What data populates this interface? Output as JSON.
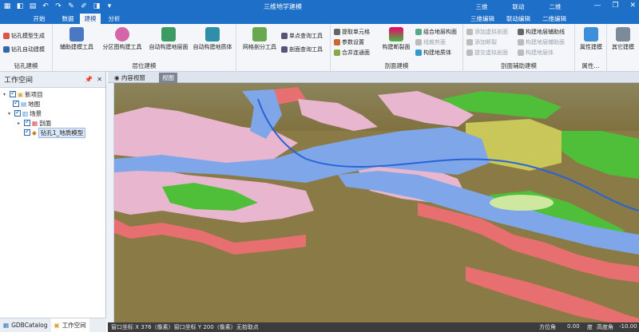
{
  "app": {
    "title": "三维地学建模"
  },
  "context_groups": {
    "g1": "三维",
    "g2": "联动",
    "g3": "二维"
  },
  "tabs": [
    "开始",
    "数据",
    "建模",
    "分析"
  ],
  "context_tabs": [
    "三维编辑",
    "联动编辑",
    "二维编辑"
  ],
  "ribbon": {
    "drill_group": {
      "label": "钻孔建模",
      "items": [
        "钻孔模型生成",
        "钻孔自动建模"
      ]
    },
    "layer_group": {
      "label": "层位建模",
      "items": [
        "辅助建模工具",
        "分区图构建工具",
        "自动构建地层面",
        "自动构建地质体"
      ]
    },
    "grid_group": {
      "items": [
        "网格剖分工具",
        "单点查询工具",
        "剖面查询工具"
      ]
    },
    "section_group": {
      "label": "剖面建模",
      "items": [
        "提取单元格",
        "参数设置",
        "合并连通面",
        "构建断裂面",
        "组合地层构面",
        "线裁剪面",
        "构建地质体"
      ]
    },
    "aux_group": {
      "label": "剖面辅助建模",
      "items": [
        "添加虚拟剖面",
        "添加断裂",
        "提交虚拟剖面",
        "构建地层辅助线",
        "构建地层辅助面",
        "构建地层体"
      ]
    },
    "attr_group": {
      "label": "属性...",
      "items": [
        "属性建模"
      ]
    },
    "other_group": {
      "items": [
        "其它建模"
      ]
    }
  },
  "workspace": {
    "title": "工作空间",
    "tree": [
      "新项目",
      "地图",
      "场景",
      "剖面",
      "钻孔1_地质模型"
    ],
    "tabs": [
      "GDBCatalog",
      "工作空间"
    ]
  },
  "view": {
    "tabs": [
      "内容视窗",
      "视图"
    ]
  },
  "status": {
    "coords": "窗口坐标 X 376（像素）窗口坐标 Y 200（像素）无拾取点",
    "azimuth_label": "方位角",
    "azimuth_value": "0.00",
    "azimuth_unit": "度",
    "pitch_label": "高度角",
    "pitch_value": "-10.00"
  },
  "colors": {
    "accent": "#1e6fc8",
    "water": "#7fa6e8",
    "vegetation": "#4fbf3a",
    "mountain": "#e8b7cf",
    "cliff": "#e86f6f",
    "ground": "#8a7a45"
  }
}
